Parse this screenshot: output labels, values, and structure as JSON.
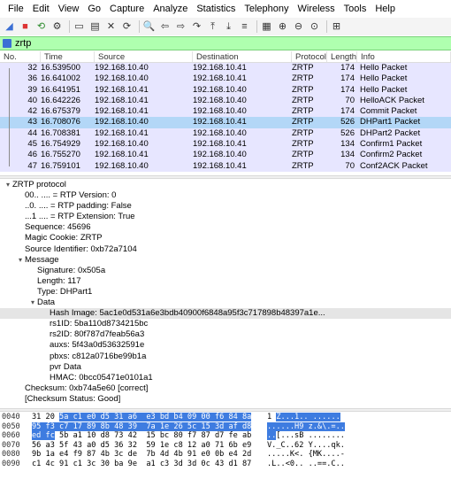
{
  "menu": [
    "File",
    "Edit",
    "View",
    "Go",
    "Capture",
    "Analyze",
    "Statistics",
    "Telephony",
    "Wireless",
    "Tools",
    "Help"
  ],
  "toolbar": {
    "icons": [
      "shark-fin-start-icon",
      "stop-icon",
      "restart-icon",
      "options-gear-icon",
      "open-file-icon",
      "save-icon",
      "close-file-icon",
      "reload-icon",
      "find-icon",
      "back-arrow-icon",
      "forward-arrow-icon",
      "go-to-packet-icon",
      "first-packet-icon",
      "last-packet-icon",
      "autoscroll-icon",
      "colorize-icon",
      "zoom-in-icon",
      "zoom-out-icon",
      "normal-size-icon",
      "resize-columns-icon"
    ]
  },
  "filter": {
    "value": "zrtp"
  },
  "packet_list": {
    "columns": [
      "No.",
      "Time",
      "Source",
      "Destination",
      "Protocol",
      "Length",
      "Info"
    ],
    "rows": [
      {
        "no": "32",
        "time": "16.539500",
        "src": "192.168.10.40",
        "dst": "192.168.10.41",
        "proto": "ZRTP",
        "len": "174",
        "info": "Hello Packet"
      },
      {
        "no": "36",
        "time": "16.641002",
        "src": "192.168.10.40",
        "dst": "192.168.10.41",
        "proto": "ZRTP",
        "len": "174",
        "info": "Hello Packet"
      },
      {
        "no": "39",
        "time": "16.641951",
        "src": "192.168.10.41",
        "dst": "192.168.10.40",
        "proto": "ZRTP",
        "len": "174",
        "info": "Hello Packet"
      },
      {
        "no": "40",
        "time": "16.642226",
        "src": "192.168.10.41",
        "dst": "192.168.10.40",
        "proto": "ZRTP",
        "len": "70",
        "info": "HelloACK Packet"
      },
      {
        "no": "42",
        "time": "16.675379",
        "src": "192.168.10.41",
        "dst": "192.168.10.40",
        "proto": "ZRTP",
        "len": "174",
        "info": "Commit Packet"
      },
      {
        "no": "43",
        "time": "16.708076",
        "src": "192.168.10.40",
        "dst": "192.168.10.41",
        "proto": "ZRTP",
        "len": "526",
        "info": "DHPart1 Packet"
      },
      {
        "no": "44",
        "time": "16.708381",
        "src": "192.168.10.41",
        "dst": "192.168.10.40",
        "proto": "ZRTP",
        "len": "526",
        "info": "DHPart2 Packet"
      },
      {
        "no": "45",
        "time": "16.754929",
        "src": "192.168.10.40",
        "dst": "192.168.10.41",
        "proto": "ZRTP",
        "len": "134",
        "info": "Confirm1 Packet"
      },
      {
        "no": "46",
        "time": "16.755270",
        "src": "192.168.10.41",
        "dst": "192.168.10.40",
        "proto": "ZRTP",
        "len": "134",
        "info": "Confirm2 Packet"
      },
      {
        "no": "47",
        "time": "16.759101",
        "src": "192.168.10.40",
        "dst": "192.168.10.41",
        "proto": "ZRTP",
        "len": "70",
        "info": "Conf2ACK Packet"
      }
    ],
    "selected_index": 5
  },
  "details": [
    {
      "indent": 0,
      "arrow": "down",
      "text": "ZRTP protocol"
    },
    {
      "indent": 1,
      "arrow": "",
      "text": "00.. .... = RTP Version: 0"
    },
    {
      "indent": 1,
      "arrow": "",
      "text": "..0. .... = RTP padding: False"
    },
    {
      "indent": 1,
      "arrow": "",
      "text": "...1 .... = RTP Extension: True"
    },
    {
      "indent": 1,
      "arrow": "",
      "text": "Sequence: 45696"
    },
    {
      "indent": 1,
      "arrow": "",
      "text": "Magic Cookie: ZRTP"
    },
    {
      "indent": 1,
      "arrow": "",
      "text": "Source Identifier: 0xb72a7104"
    },
    {
      "indent": 1,
      "arrow": "down",
      "text": "Message"
    },
    {
      "indent": 2,
      "arrow": "",
      "text": "Signature: 0x505a"
    },
    {
      "indent": 2,
      "arrow": "",
      "text": "Length: 117"
    },
    {
      "indent": 2,
      "arrow": "",
      "text": "Type: DHPart1"
    },
    {
      "indent": 2,
      "arrow": "down",
      "text": "Data"
    },
    {
      "indent": 3,
      "arrow": "",
      "text": "Hash Image: 5ac1e0d531a6e3bdb40900f6848a95f3c717898b48397a1e...",
      "highlight": true
    },
    {
      "indent": 3,
      "arrow": "",
      "text": "rs1ID: 5ba110d8734215bc"
    },
    {
      "indent": 3,
      "arrow": "",
      "text": "rs2ID: 80f787d7feab56a3"
    },
    {
      "indent": 3,
      "arrow": "",
      "text": "auxs: 5f43a0d53632591e"
    },
    {
      "indent": 3,
      "arrow": "",
      "text": "pbxs: c812a0716be99b1a"
    },
    {
      "indent": 3,
      "arrow": "",
      "text": "pvr Data"
    },
    {
      "indent": 3,
      "arrow": "",
      "text": "HMAC: 0bcc05471e0101a1"
    },
    {
      "indent": 1,
      "arrow": "",
      "text": "Checksum: 0xb74a5e60 [correct]"
    },
    {
      "indent": 1,
      "arrow": "",
      "text": "[Checksum Status: Good]"
    }
  ],
  "bytes": [
    {
      "offset": "0040",
      "hex_pre": "31 20 ",
      "hex_sel": "5a c1 e0 d5 31 a6  e3 bd b4 09 00 f6 84 8a",
      "hex_post": "",
      "asc_pre": "1 ",
      "asc_sel": "Z...1.. ......",
      "asc_post": ""
    },
    {
      "offset": "0050",
      "hex_pre": "",
      "hex_sel": "95 f3 c7 17 89 8b 48 39  7a 1e 26 5c 15 3d af d8",
      "hex_post": "",
      "asc_pre": "",
      "asc_sel": "......H9 z.&\\.=..",
      "asc_post": ""
    },
    {
      "offset": "0060",
      "hex_pre": "",
      "hex_sel": "ed fc",
      "hex_post": " 5b a1 10 d8 73 42  15 bc 80 f7 87 d7 fe ab",
      "asc_pre": "",
      "asc_sel": "..",
      "asc_post": "[...sB ........"
    },
    {
      "offset": "0070",
      "hex_pre": "",
      "hex_sel": "",
      "hex_post": "56 a3 5f 43 a0 d5 36 32  59 1e c8 12 a0 71 6b e9",
      "asc_pre": "",
      "asc_sel": "",
      "asc_post": "V._C..62 Y....qk."
    },
    {
      "offset": "0080",
      "hex_pre": "",
      "hex_sel": "",
      "hex_post": "9b 1a e4 f9 87 4b 3c de  7b 4d 4b 91 e0 0b e4 2d",
      "asc_pre": "",
      "asc_sel": "",
      "asc_post": ".....K<. {MK....-"
    },
    {
      "offset": "0090",
      "hex_pre": "",
      "hex_sel": "",
      "hex_post": "c1 4c 91 c1 3c 30 ba 9e  a1 c3 3d 3d 0c 43 d1 87",
      "asc_pre": "",
      "asc_sel": "",
      "asc_post": ".L..<0.. ..==.C.."
    }
  ]
}
